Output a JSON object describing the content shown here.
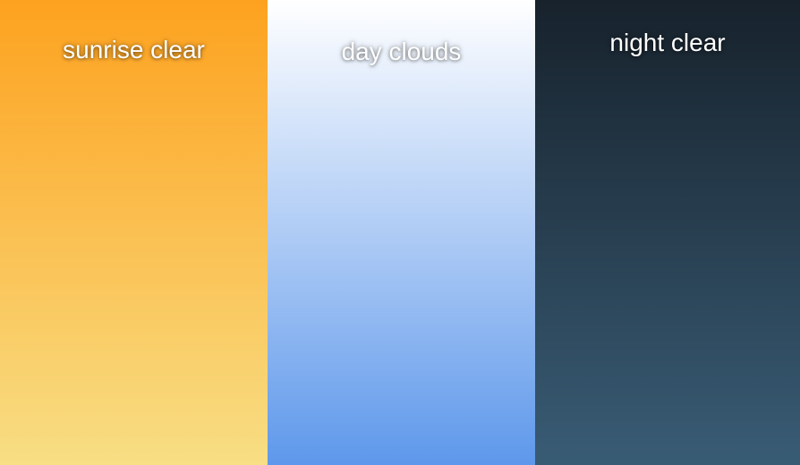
{
  "panels": [
    {
      "label": "sunrise clear",
      "gradient_top": "#FDA21F",
      "gradient_bottom": "#F8DE84"
    },
    {
      "label": "day clouds",
      "gradient_top": "#FFFFFF",
      "gradient_bottom": "#5E98EB"
    },
    {
      "label": "night clear",
      "gradient_top": "#17222C",
      "gradient_bottom": "#395C75"
    }
  ]
}
